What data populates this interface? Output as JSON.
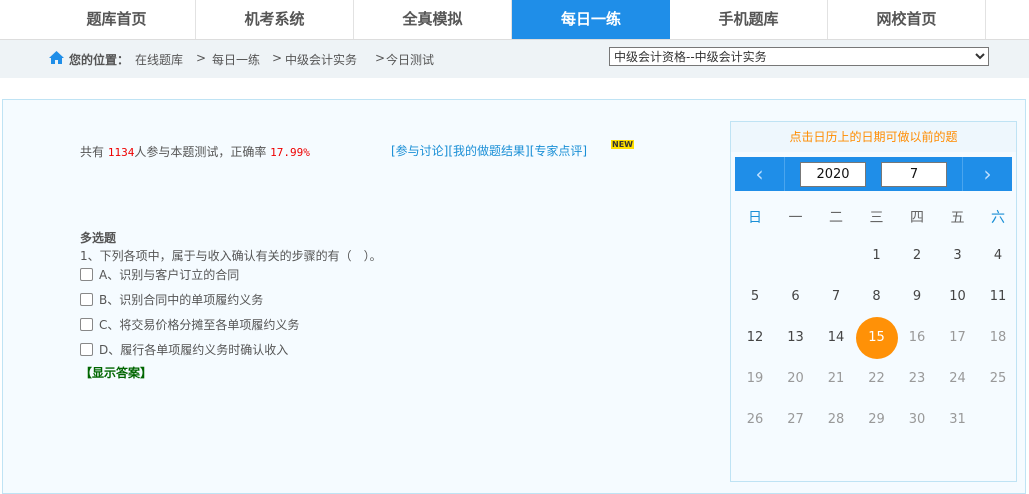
{
  "nav": {
    "tabs": [
      {
        "label": "题库首页"
      },
      {
        "label": "机考系统"
      },
      {
        "label": "全真模拟"
      },
      {
        "label": "每日一练",
        "active": true
      },
      {
        "label": "手机题库"
      },
      {
        "label": "网校首页"
      }
    ]
  },
  "breadcrumb": {
    "prefix": "您的位置：",
    "items": [
      "在线题库",
      "每日一练",
      "中级会计实务",
      "今日测试"
    ],
    "sep": ">"
  },
  "exam_select": {
    "value": "中级会计资格--中级会计实务"
  },
  "stats": {
    "pre": "共有 ",
    "count": "1134",
    "mid": "人参与本题测试，正确率 ",
    "rate": "17.99%"
  },
  "links": [
    "[参与讨论]",
    "[我的做题结果]",
    "[专家点评]"
  ],
  "new_badge": "NEW",
  "question": {
    "type": "多选题",
    "text": "1、下列各项中，属于与收入确认有关的步骤的有（　）。",
    "options": [
      "A、识别与客户订立的合同",
      "B、识别合同中的单项履约义务",
      "C、将交易价格分摊至各单项履约义务",
      "D、履行各单项履约义务时确认收入"
    ],
    "show_answer": "【显示答案】"
  },
  "calendar": {
    "hint": "点击日历上的日期可做以前的题",
    "year": "2020",
    "month": "7",
    "prev": "‹",
    "next": "›",
    "weekdays": [
      "日",
      "一",
      "二",
      "三",
      "四",
      "五",
      "六"
    ],
    "first_weekday": 3,
    "days_in_month": 31,
    "selected_day": 15,
    "accent": "#ff9107"
  }
}
